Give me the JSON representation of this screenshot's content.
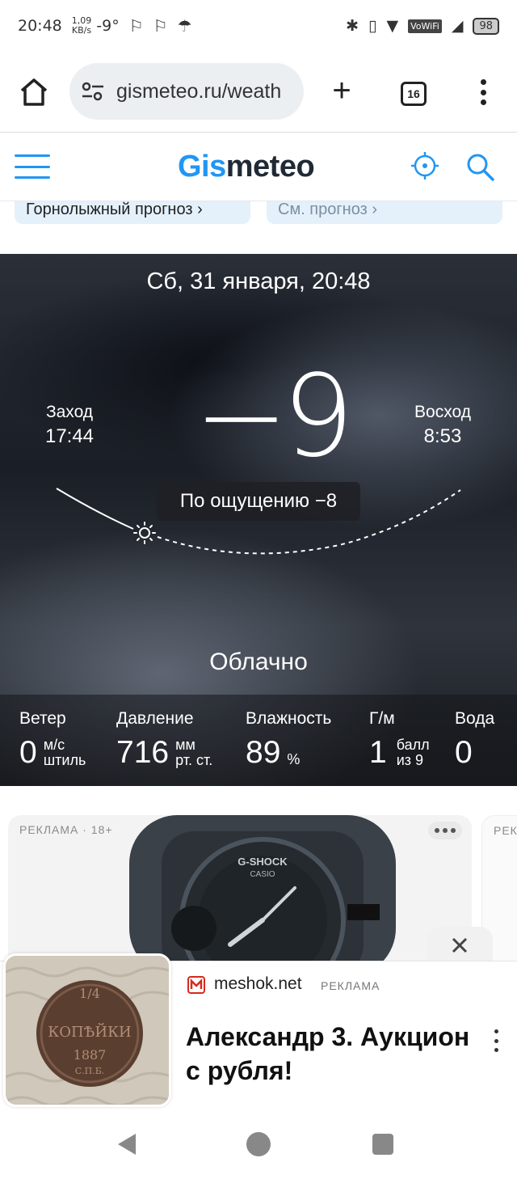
{
  "status_bar": {
    "time": "20:48",
    "speed": "1,09",
    "speed_unit": "KB/s",
    "temp": "-9°",
    "vowifi": "VoWiFi",
    "battery": "98"
  },
  "browser": {
    "url": "gismeteo.ru/weath",
    "tab_count": "16"
  },
  "site": {
    "logo_part1": "Gis",
    "logo_part2": "meteo",
    "quick_links": [
      "Горнолыжный прогноз ›",
      "См. прогноз ›"
    ]
  },
  "weather": {
    "date": "Сб, 31 января, 20:48",
    "temperature": "−9",
    "sunset_label": "Заход",
    "sunset_time": "17:44",
    "sunrise_label": "Восход",
    "sunrise_time": "8:53",
    "feels_like": "По ощущению −8",
    "condition": "Облачно",
    "stats": {
      "wind": {
        "label": "Ветер",
        "value": "0",
        "unit1": "м/c",
        "unit2": "штиль"
      },
      "pressure": {
        "label": "Давление",
        "value": "716",
        "unit1": "мм",
        "unit2": "рт. ст."
      },
      "humidity": {
        "label": "Влажность",
        "value": "89",
        "unit": "%"
      },
      "geomagnetic": {
        "label": "Г/м",
        "value": "1",
        "unit1": "балл",
        "unit2": "из 9"
      },
      "water": {
        "label": "Вода",
        "value": "0"
      }
    }
  },
  "ads": {
    "card_tag": "РЕКЛАМА · 18+",
    "card2_tag": "РЕК",
    "watch_brand": "G-SHOCK",
    "watch_sub": "CASIO",
    "banner_brand": "meshok.net",
    "banner_tag": "РЕКЛАМА",
    "banner_title": "Александр 3. Аукцион с рубля!",
    "coin_fraction": "1/4",
    "coin_word": "КОПѢЙКИ",
    "coin_year": "1887",
    "coin_mint": "С.П.Б."
  },
  "colors": {
    "brand_blue": "#2196f3",
    "logo_dark": "#1f2a36"
  }
}
